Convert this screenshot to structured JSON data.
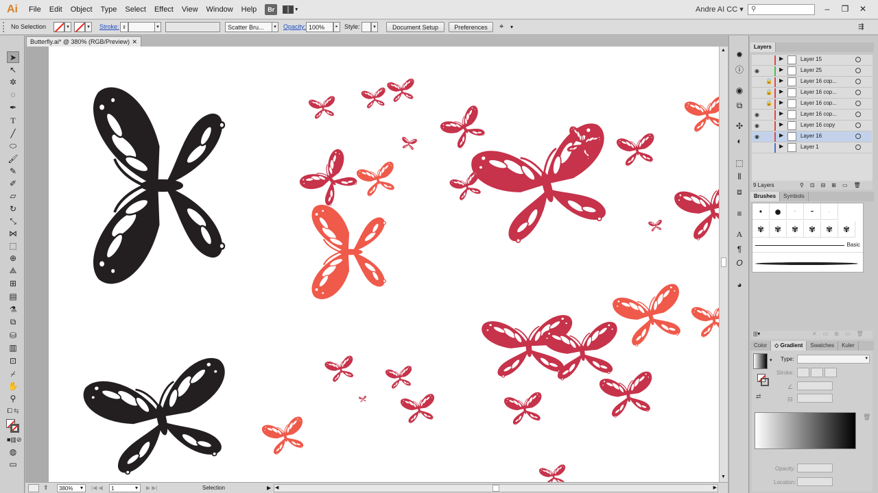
{
  "app": {
    "logo": "Ai",
    "user": "Andre AI CC ▾",
    "bridge_label": "Br"
  },
  "menu": [
    "File",
    "Edit",
    "Object",
    "Type",
    "Select",
    "Effect",
    "View",
    "Window",
    "Help"
  ],
  "control_bar": {
    "selection_status": "No Selection",
    "stroke_label": "Stroke:",
    "brush_name": "Scatter Bru...",
    "opacity_label": "Opacity:",
    "opacity_value": "100%",
    "style_label": "Style:",
    "document_setup": "Document Setup",
    "preferences": "Preferences"
  },
  "document": {
    "tab_title": "Butterfly.ai* @ 380% (RGB/Preview)",
    "zoom": "380%",
    "artboard": "1",
    "status_tool": "Selection"
  },
  "colors": {
    "black_butterfly": "#231f20",
    "crimson_butterfly": "#c6334a",
    "coral_butterfly": "#ef5a4b",
    "canvas": "#ffffff",
    "selected_layer": "#c3d2ea"
  },
  "layers_panel": {
    "tab": "Layers",
    "count_label": "9 Layers",
    "rows": [
      {
        "name": "Layer 15",
        "visible": false,
        "locked": false,
        "color": "#e04848"
      },
      {
        "name": "Layer 25",
        "visible": true,
        "locked": false,
        "color": "#48c048"
      },
      {
        "name": "Layer 16 cop...",
        "visible": false,
        "locked": true,
        "color": "#e04848"
      },
      {
        "name": "Layer 16 cop...",
        "visible": false,
        "locked": true,
        "color": "#e04848"
      },
      {
        "name": "Layer 16 cop...",
        "visible": false,
        "locked": true,
        "color": "#e04848"
      },
      {
        "name": "Layer 16 cop...",
        "visible": true,
        "locked": false,
        "color": "#e04848"
      },
      {
        "name": "Layer 16 copy",
        "visible": true,
        "locked": false,
        "color": "#e04848"
      },
      {
        "name": "Layer 16",
        "visible": true,
        "locked": false,
        "color": "#e04848",
        "selected": true
      },
      {
        "name": "Layer 1",
        "visible": false,
        "locked": false,
        "color": "#4a6fd8"
      }
    ]
  },
  "brushes_panel": {
    "tabs": [
      "Brushes",
      "Symbols"
    ],
    "basic_label": "Basic"
  },
  "gradient_panel": {
    "tabs": [
      "Color",
      "◇ Gradient",
      "Swatches",
      "Kuler"
    ],
    "type_label": "Type:",
    "stroke_label": "Stroke:",
    "opacity_label": "Opacity:",
    "location_label": "Location:"
  }
}
